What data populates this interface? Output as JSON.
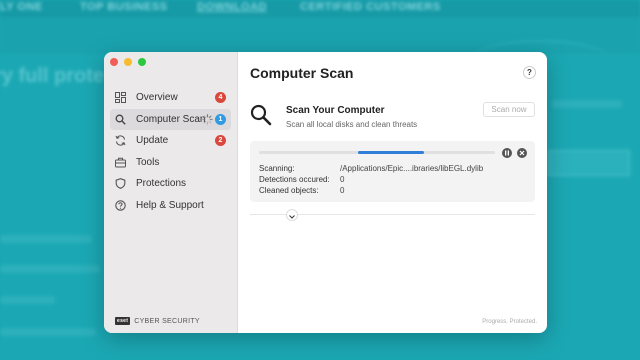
{
  "background": {
    "nav_items": [
      "LY ONE",
      "TOP BUSINESS",
      "DOWNLOAD",
      "CERTIFIED CUSTOMERS"
    ],
    "hero_text": "ry full prote"
  },
  "window": {
    "traffic_colors": [
      "#ef5f57",
      "#f6bc2f",
      "#2bc840"
    ]
  },
  "sidebar": {
    "items": [
      {
        "label": "Overview",
        "icon": "overview-icon",
        "badge": "4",
        "badge_color": "#d9473d"
      },
      {
        "label": "Computer Scan",
        "icon": "search-icon",
        "badge": "1",
        "badge_color": "#2f9be0",
        "active": true,
        "spinner": true
      },
      {
        "label": "Update",
        "icon": "update-icon",
        "badge": "2",
        "badge_color": "#d9473d"
      },
      {
        "label": "Tools",
        "icon": "tools-icon"
      },
      {
        "label": "Protections",
        "icon": "shield-icon"
      },
      {
        "label": "Help & Support",
        "icon": "help-icon"
      }
    ],
    "brand_logo": "eset",
    "brand_text": "CYBER SECURITY"
  },
  "main": {
    "title": "Computer Scan",
    "help_label": "?",
    "scan": {
      "heading": "Scan Your Computer",
      "subtitle": "Scan all local disks and clean threats",
      "button_label": "Scan now"
    },
    "progress": {
      "fraction": 0.28,
      "offset": 0.42,
      "rows": [
        {
          "label": "Scanning:",
          "value": "/Applications/Epic....ibraries/libEGL.dylib"
        },
        {
          "label": "Detections occured:",
          "value": "0"
        },
        {
          "label": "Cleaned objects:",
          "value": "0"
        }
      ]
    },
    "footer": "Progress. Protected."
  },
  "colors": {
    "accent": "#2f7fd9",
    "background": "#1aa6b3",
    "badge_red": "#d9473d",
    "badge_blue": "#2f9be0"
  }
}
